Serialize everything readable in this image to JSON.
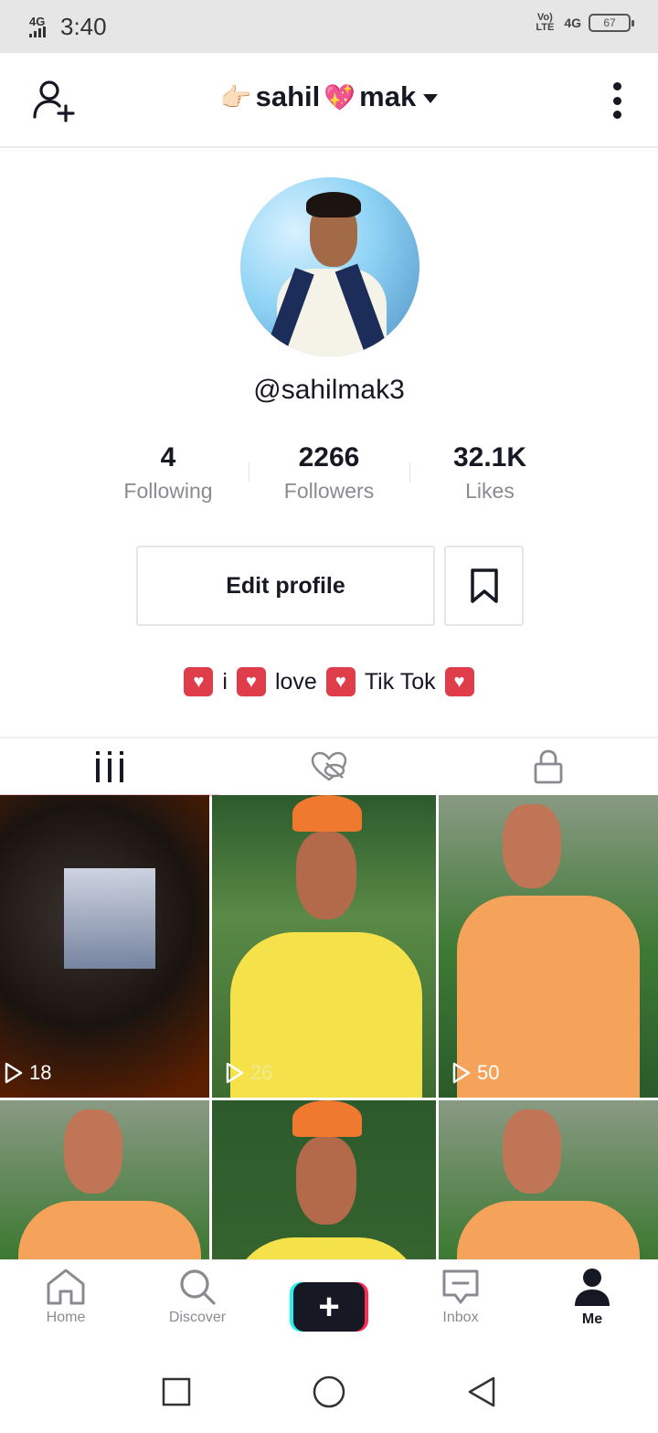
{
  "status_bar": {
    "network_left": "4G",
    "time": "3:40",
    "volte": "Vo) LTE",
    "network_right": "4G",
    "battery": "67"
  },
  "header": {
    "title_prefix_emoji": "👉🏻",
    "title_part1": "sahil",
    "title_heart_emoji": "💖",
    "title_part2": "mak",
    "add_user_icon": "add-user-icon",
    "more_icon": "more-vertical-icon"
  },
  "profile": {
    "username": "@sahilmak3",
    "stats": [
      {
        "value": "4",
        "label": "Following"
      },
      {
        "value": "2266",
        "label": "Followers"
      },
      {
        "value": "32.1K",
        "label": "Likes"
      }
    ],
    "edit_profile_label": "Edit profile",
    "bio": {
      "word1": "i",
      "word2": "love",
      "word3": "Tik Tok",
      "heart": "♥"
    }
  },
  "tabs": [
    {
      "name": "videos",
      "icon": "grid-icon",
      "active": true
    },
    {
      "name": "liked",
      "icon": "heart-hidden-icon",
      "active": false
    },
    {
      "name": "private",
      "icon": "lock-icon",
      "active": false
    }
  ],
  "videos": [
    {
      "views": "18"
    },
    {
      "views": "26"
    },
    {
      "views": "50"
    },
    {
      "views": ""
    },
    {
      "views": ""
    },
    {
      "views": ""
    }
  ],
  "bottom_nav": {
    "home": "Home",
    "discover": "Discover",
    "create": "+",
    "inbox": "Inbox",
    "me": "Me"
  },
  "colors": {
    "text_primary": "#161823",
    "text_secondary": "#8a8b91",
    "brand_cyan": "#25f4ee",
    "brand_pink": "#fe2c55",
    "bio_heart": "#e03d4a"
  }
}
